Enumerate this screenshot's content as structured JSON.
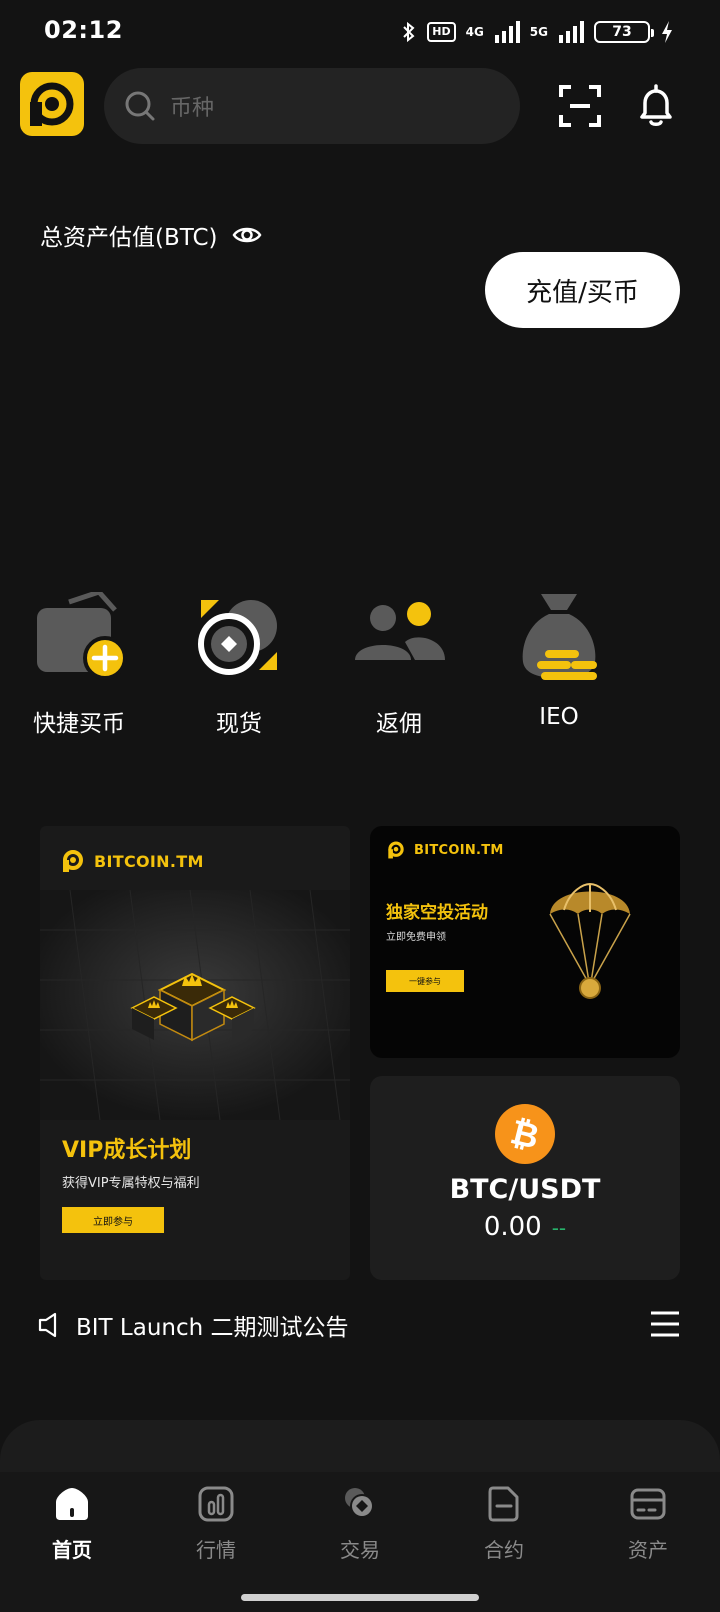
{
  "status_bar": {
    "time": "02:12",
    "hd": "HD",
    "net_4g": "4G",
    "net_5g": "5G",
    "battery": "73",
    "icons": [
      "bluetooth-icon",
      "signal-icon",
      "battery-icon",
      "charging-icon"
    ]
  },
  "header": {
    "search_placeholder": "币种",
    "icons": [
      "logo-icon",
      "search-icon",
      "scan-icon",
      "bell-icon"
    ]
  },
  "assets": {
    "label": "总资产估值(BTC)",
    "deposit_button": "充值/买币",
    "icons": [
      "eye-icon"
    ]
  },
  "quick_actions": [
    {
      "label": "快捷买币",
      "icon": "wallet-plus-icon"
    },
    {
      "label": "现货",
      "icon": "spot-coin-icon"
    },
    {
      "label": "返佣",
      "icon": "users-icon"
    },
    {
      "label": "IEO",
      "icon": "money-bag-icon"
    }
  ],
  "banners": {
    "vip": {
      "brand": "BITCOIN.TM",
      "title": "VIP成长计划",
      "subtitle": "获得VIP专属特权与福利",
      "button": "立即参与"
    },
    "airdrop": {
      "brand": "BITCOIN.TM",
      "title": "独家空投活动",
      "subtitle": "立即免费申领",
      "button": "一键参与"
    }
  },
  "ticker": {
    "pair": "BTC/USDT",
    "price": "0.00",
    "change": "--",
    "icon": "bitcoin-icon"
  },
  "announcement": {
    "text": "BIT Launch 二期测试公告",
    "icons": [
      "speaker-icon",
      "menu-icon"
    ]
  },
  "bottom_nav": {
    "active": "首页",
    "items": [
      {
        "label": "首页",
        "icon": "home-icon"
      },
      {
        "label": "行情",
        "icon": "market-icon"
      },
      {
        "label": "交易",
        "icon": "trade-icon"
      },
      {
        "label": "合约",
        "icon": "contract-icon"
      },
      {
        "label": "资产",
        "icon": "assets-card-icon"
      }
    ]
  },
  "colors": {
    "background": "#131313",
    "accent": "#f4c20d",
    "bitcoin": "#f7931a",
    "change_green": "#27b36b",
    "muted": "#8a8a8a"
  }
}
